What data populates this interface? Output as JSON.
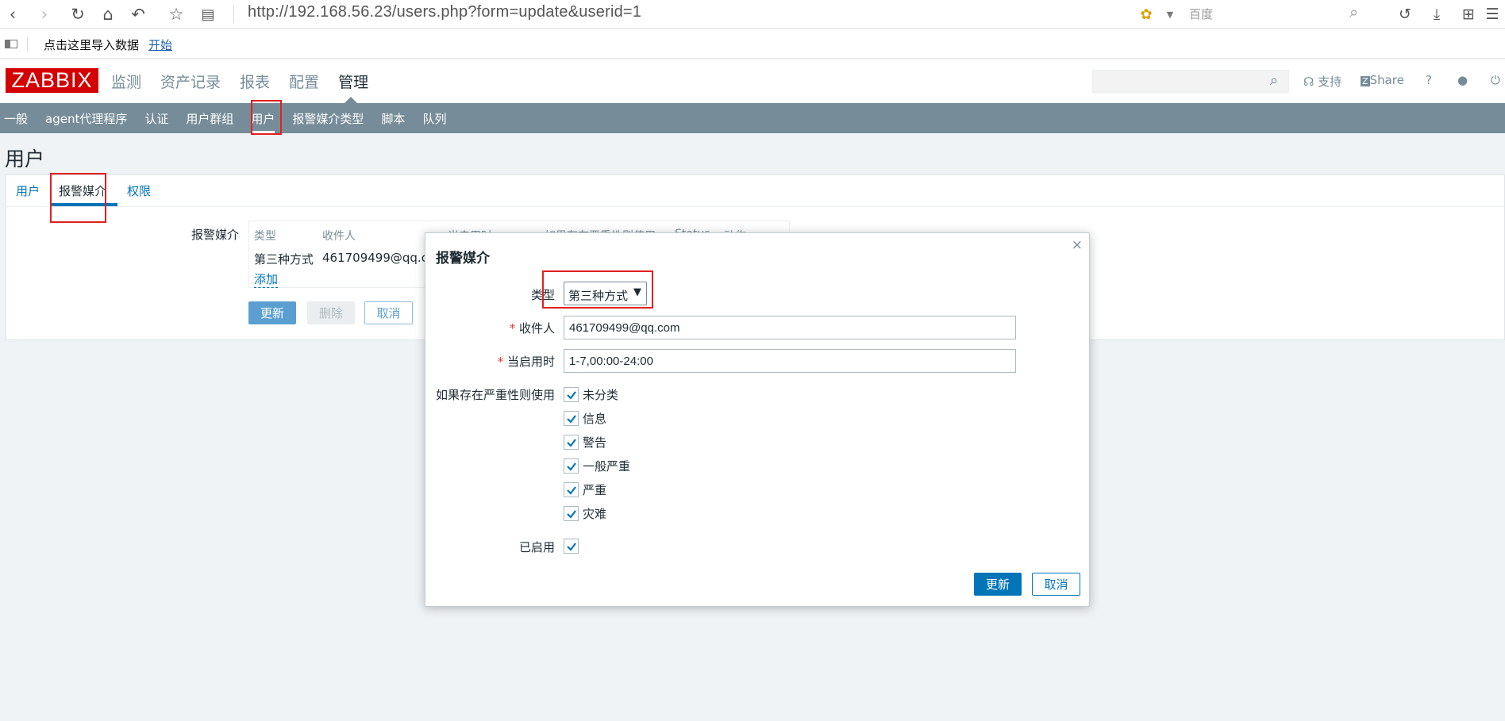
{
  "browser": {
    "url": "http://192.168.56.23/users.php?form=update&userid=1",
    "search_engine": "百度",
    "bookmark_text": "点击这里导入数据",
    "bookmark_link": "开始"
  },
  "header": {
    "logo": "ZABBIX",
    "menu": [
      "监测",
      "资产记录",
      "报表",
      "配置",
      "管理"
    ],
    "support": "支持",
    "share": "Share",
    "help": "?"
  },
  "subnav": [
    "一般",
    "agent代理程序",
    "认证",
    "用户群组",
    "用户",
    "报警媒介类型",
    "脚本",
    "队列"
  ],
  "page": {
    "title": "用户",
    "tabs": [
      "用户",
      "报警媒介",
      "权限"
    ],
    "media_label": "报警媒介",
    "table_headers": [
      "类型",
      "收件人",
      "当启用时",
      "如果存在严重性则使用",
      "Status",
      "动作"
    ],
    "row": {
      "type": "第三种方式",
      "recipient": "461709499@qq.com"
    },
    "add_link": "添加",
    "buttons": {
      "update": "更新",
      "delete": "删除",
      "cancel": "取消"
    }
  },
  "dialog": {
    "title": "报警媒介",
    "close": "×",
    "type_label": "类型",
    "type_value": "第三种方式",
    "sendto_label": "收件人",
    "sendto_value": "461709499@qq.com",
    "period_label": "当启用时",
    "period_value": "1-7,00:00-24:00",
    "severity_label": "如果存在严重性则使用",
    "severities": [
      "未分类",
      "信息",
      "警告",
      "一般严重",
      "严重",
      "灾难"
    ],
    "enabled_label": "已启用",
    "update": "更新",
    "cancel": "取消"
  },
  "colors": {
    "accent": "#0275b8",
    "subnav": "#768d99",
    "logo": "#d40000",
    "highlight": "#e02020"
  }
}
